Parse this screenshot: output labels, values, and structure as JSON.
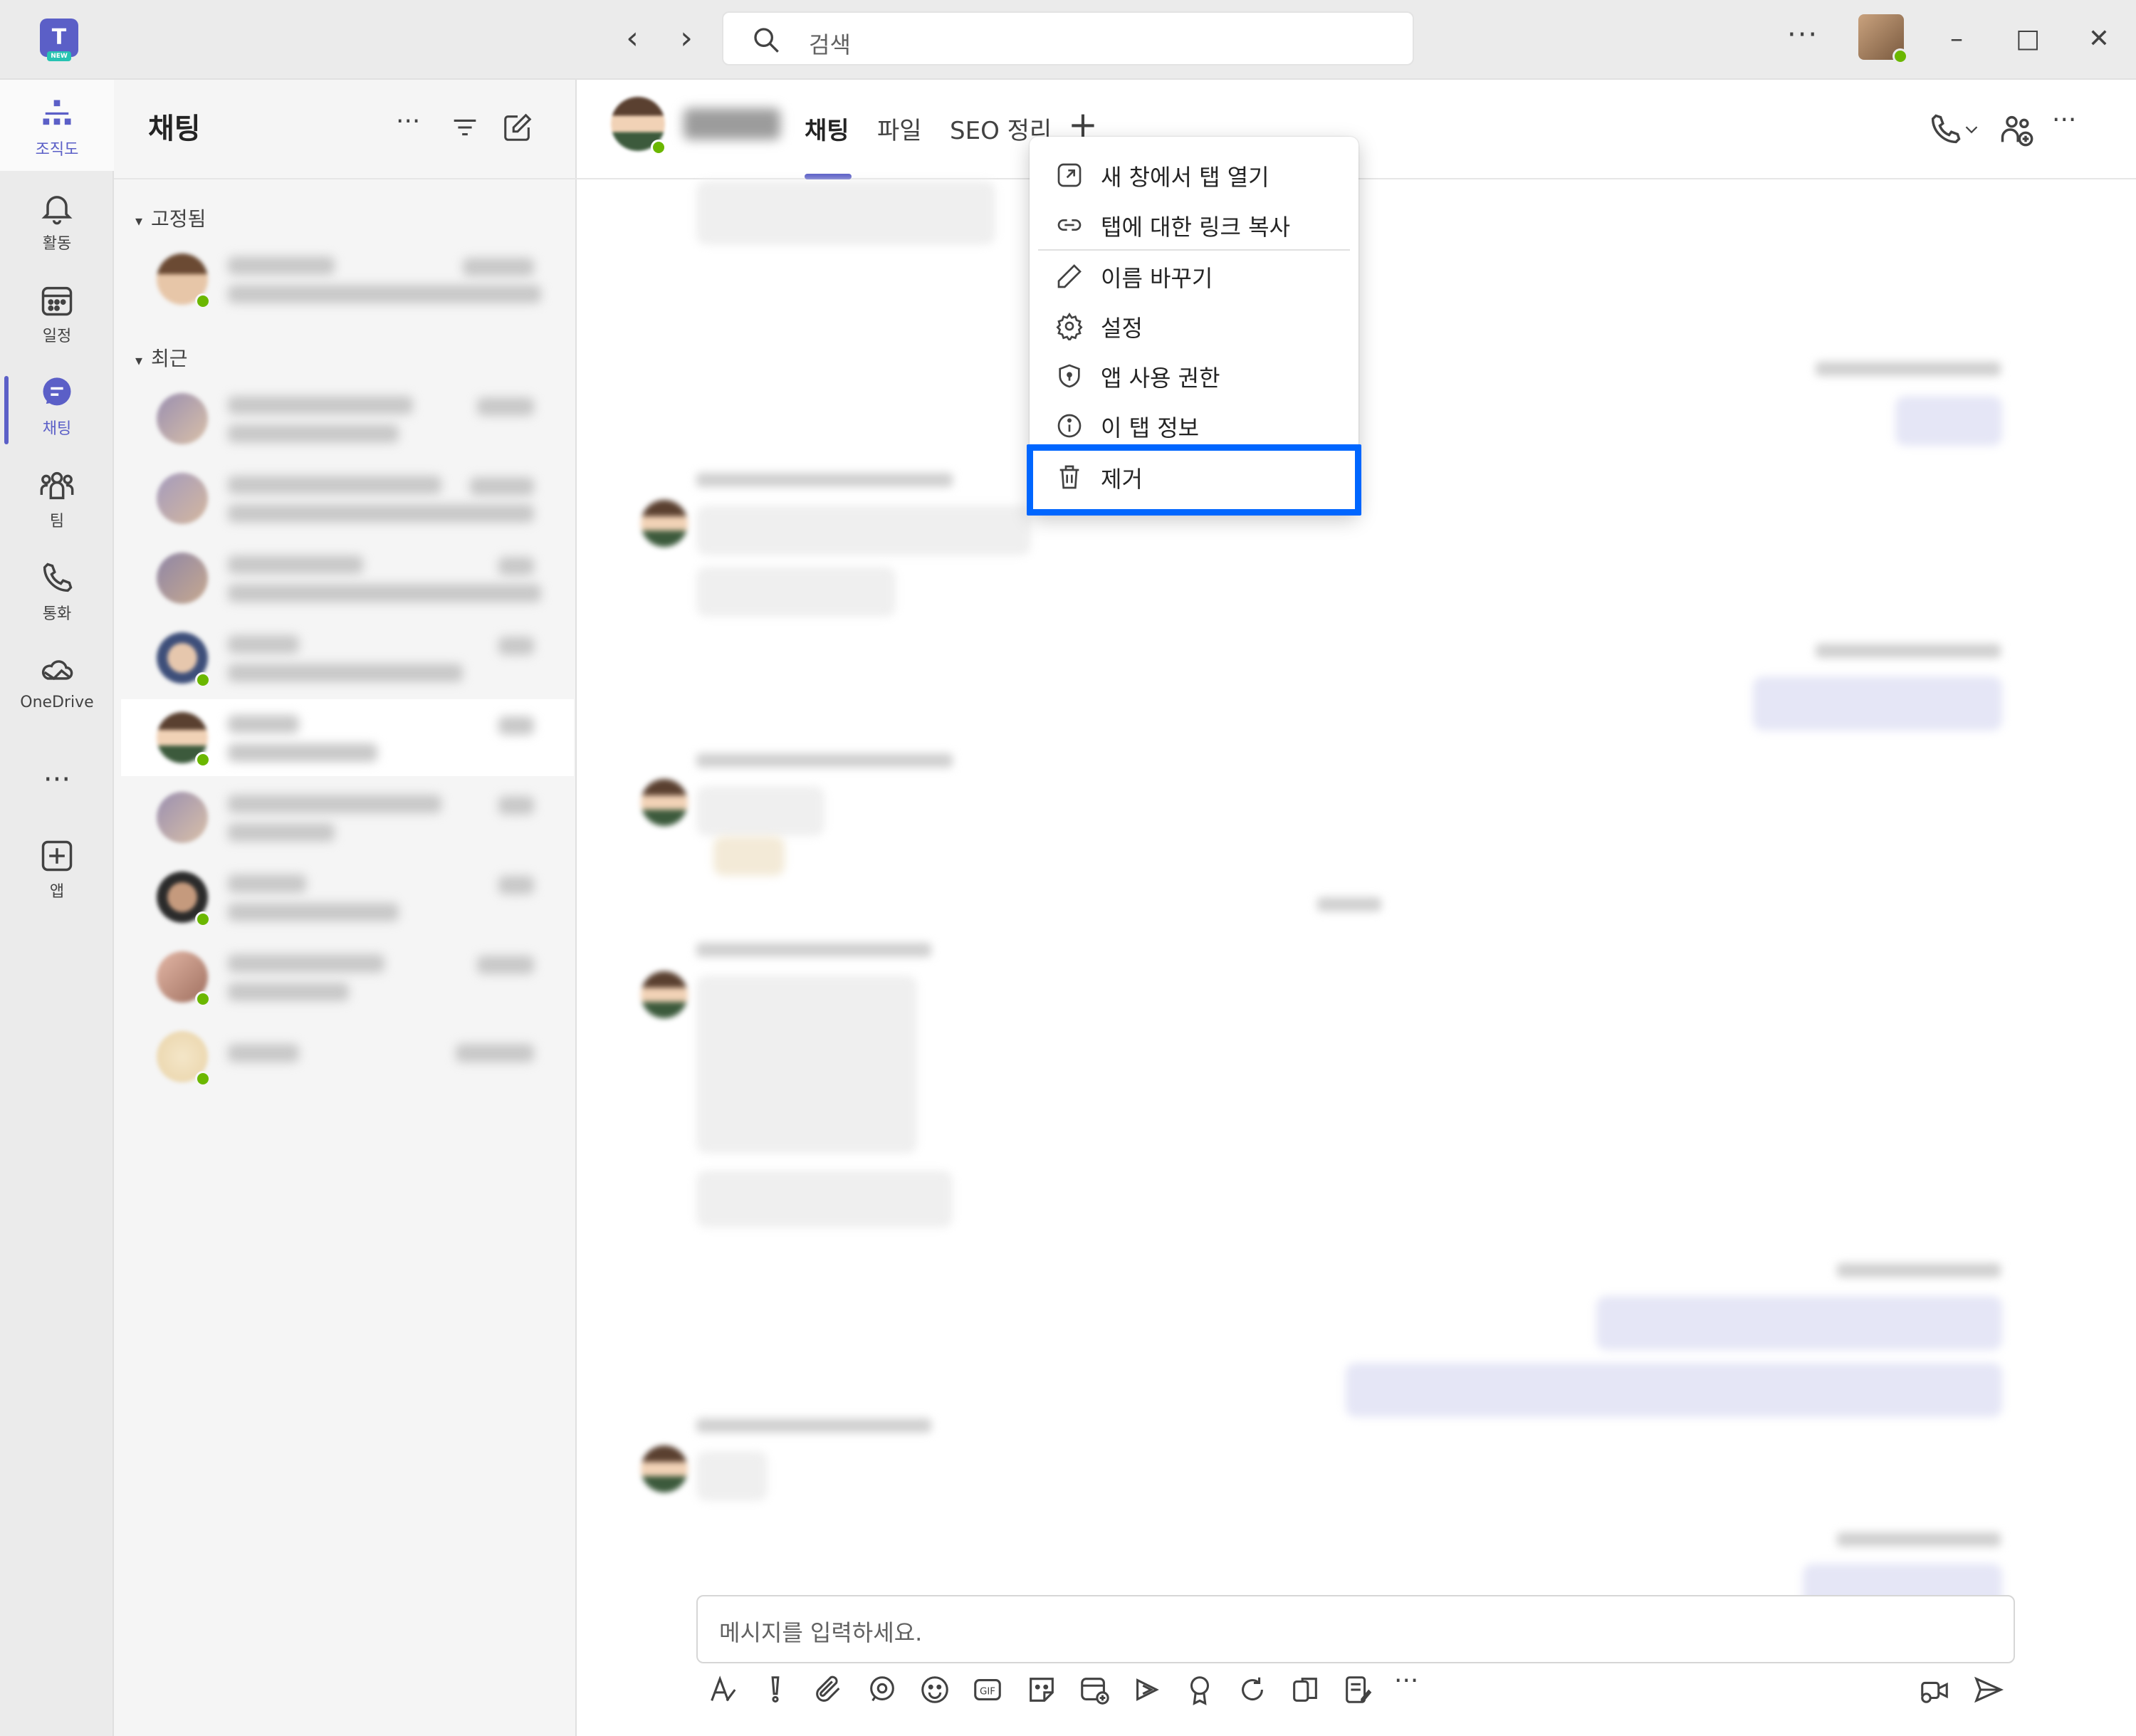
{
  "titlebar": {
    "search_placeholder": "검색",
    "more": "···"
  },
  "rail": {
    "items": [
      {
        "label": "조직도",
        "icon": "org-chart-icon"
      },
      {
        "label": "활동",
        "icon": "bell-icon"
      },
      {
        "label": "일정",
        "icon": "calendar-icon"
      },
      {
        "label": "채팅",
        "icon": "chat-icon",
        "active": true
      },
      {
        "label": "팀",
        "icon": "teams-icon"
      },
      {
        "label": "통화",
        "icon": "phone-icon"
      },
      {
        "label": "OneDrive",
        "icon": "cloud-icon"
      },
      {
        "label": "···",
        "icon": "more-icon"
      },
      {
        "label": "앱",
        "icon": "apps-icon"
      }
    ]
  },
  "chat_list": {
    "title": "채팅",
    "sections": {
      "pinned": "고정됨",
      "recent": "최근"
    }
  },
  "main": {
    "tabs": [
      {
        "label": "채팅",
        "active": true
      },
      {
        "label": "파일"
      },
      {
        "label": "SEO 정리"
      }
    ],
    "compose_placeholder": "메시지를 입력하세요."
  },
  "context_menu": {
    "items": [
      {
        "label": "새 창에서 탭 열기",
        "icon": "open-new-window-icon"
      },
      {
        "label": "탭에 대한 링크 복사",
        "icon": "link-icon"
      },
      {
        "label": "이름 바꾸기",
        "icon": "pencil-icon"
      },
      {
        "label": "설정",
        "icon": "gear-icon"
      },
      {
        "label": "앱 사용 권한",
        "icon": "shield-icon"
      },
      {
        "label": "이 탭 정보",
        "icon": "info-icon"
      },
      {
        "label": "제거",
        "icon": "trash-icon",
        "highlighted": true
      }
    ]
  },
  "colors": {
    "accent": "#5b5fc7",
    "highlight": "#0066ff",
    "presence": "#6bb700"
  }
}
